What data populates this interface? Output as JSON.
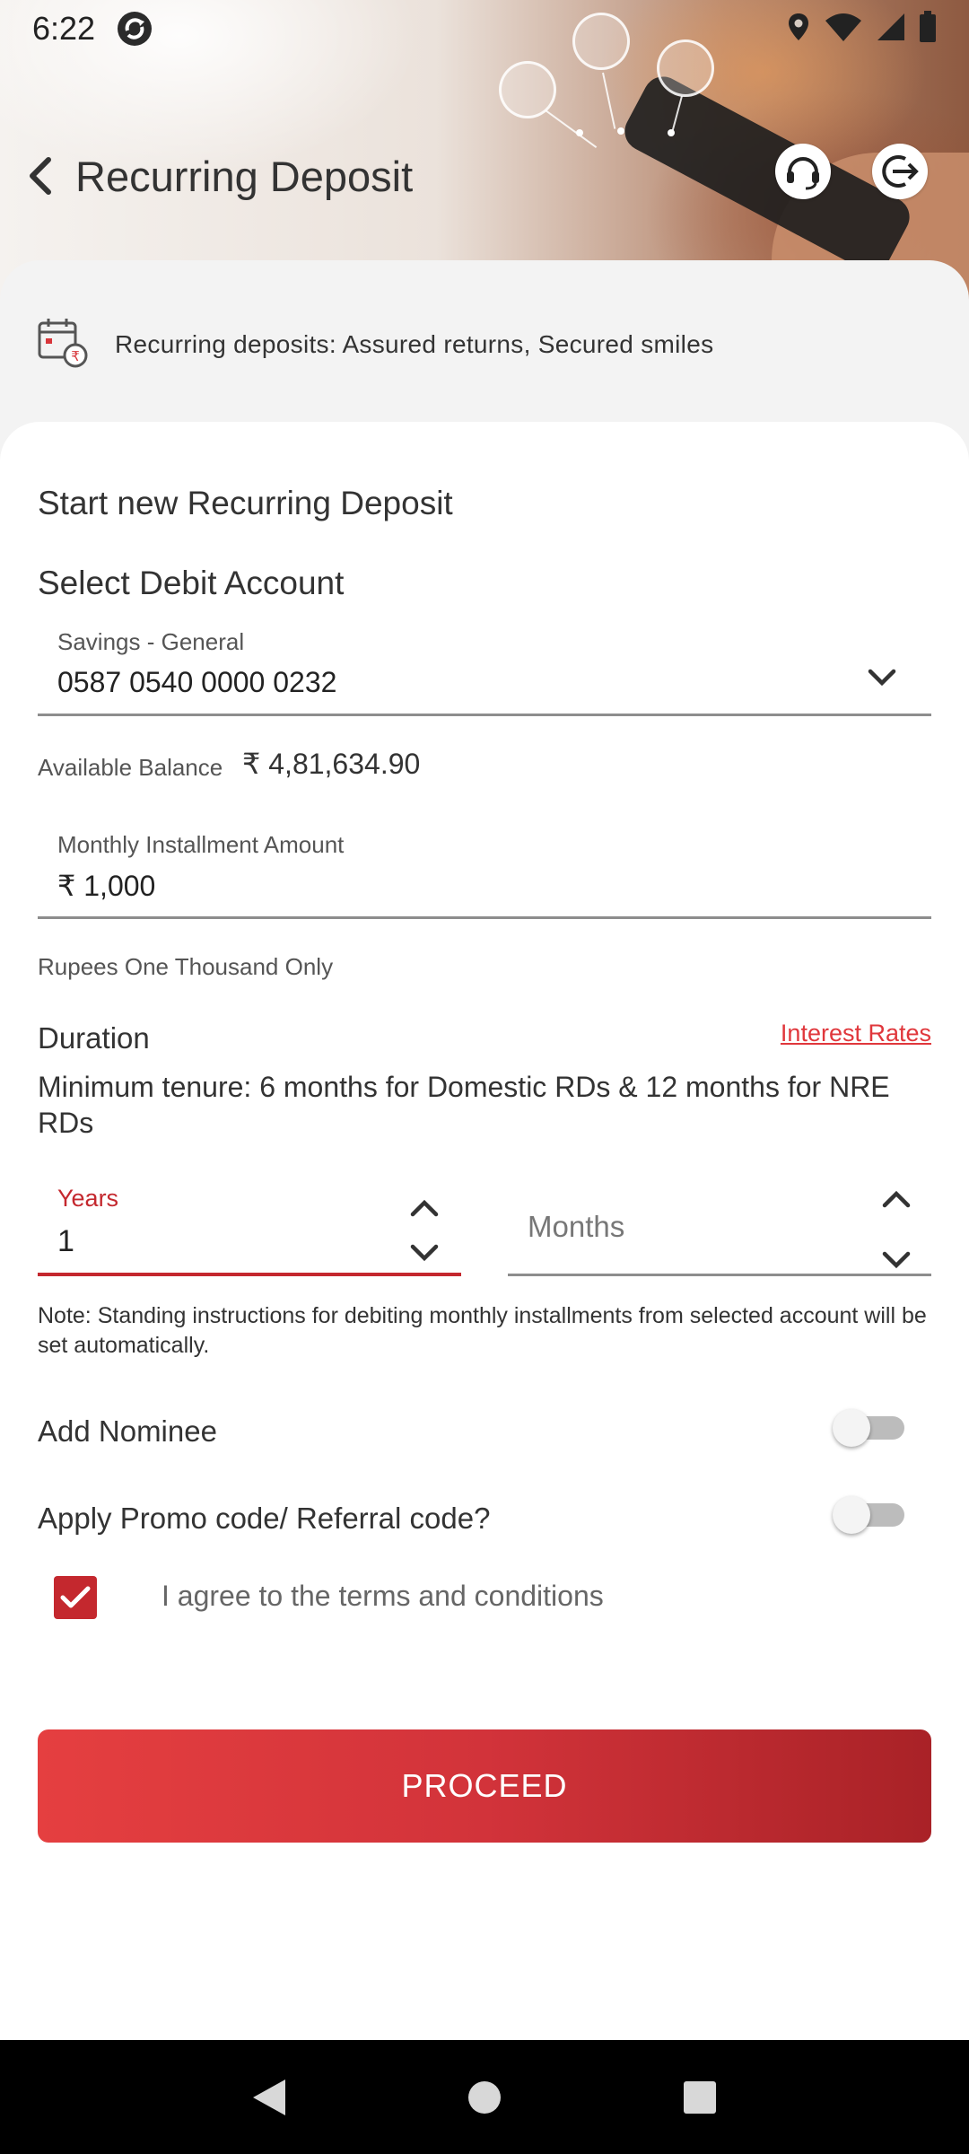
{
  "status_bar": {
    "time": "6:22",
    "icons": [
      "app-sync-icon",
      "location-icon",
      "wifi-icon",
      "signal-icon",
      "battery-icon"
    ]
  },
  "header": {
    "title": "Recurring Deposit",
    "icons": [
      "back-icon",
      "support-headset-icon",
      "logout-icon"
    ]
  },
  "banner": {
    "text": "Recurring deposits: Assured returns, Secured smiles",
    "icon": "calendar-rupee-icon"
  },
  "form": {
    "section_title": "Start new Recurring Deposit",
    "debit_account_title": "Select Debit Account",
    "account_type": "Savings - General",
    "account_number": "0587 0540 0000 0232",
    "available_balance_label": "Available Balance",
    "available_balance_value": "₹ 4,81,634.90",
    "installment_label": "Monthly Installment Amount",
    "installment_value": "₹ 1,000",
    "amount_in_words": "Rupees One Thousand Only",
    "duration_title": "Duration",
    "interest_rates_link": "Interest Rates",
    "tenure_info": "Minimum tenure: 6 months for Domestic RDs & 12 months for NRE RDs",
    "years_label": "Years",
    "years_value": "1",
    "months_placeholder": "Months",
    "note": "Note: Standing instructions for debiting monthly installments from selected account will be set automatically.",
    "add_nominee_label": "Add Nominee",
    "add_nominee_enabled": false,
    "promo_label": "Apply Promo code/ Referral code?",
    "promo_enabled": false,
    "terms_label": "I agree to the terms and conditions",
    "terms_checked": true,
    "proceed_label": "PROCEED"
  },
  "colors": {
    "accent_red": "#c4282e",
    "button_gradient_start": "#e53f40",
    "button_gradient_end": "#a92227"
  }
}
